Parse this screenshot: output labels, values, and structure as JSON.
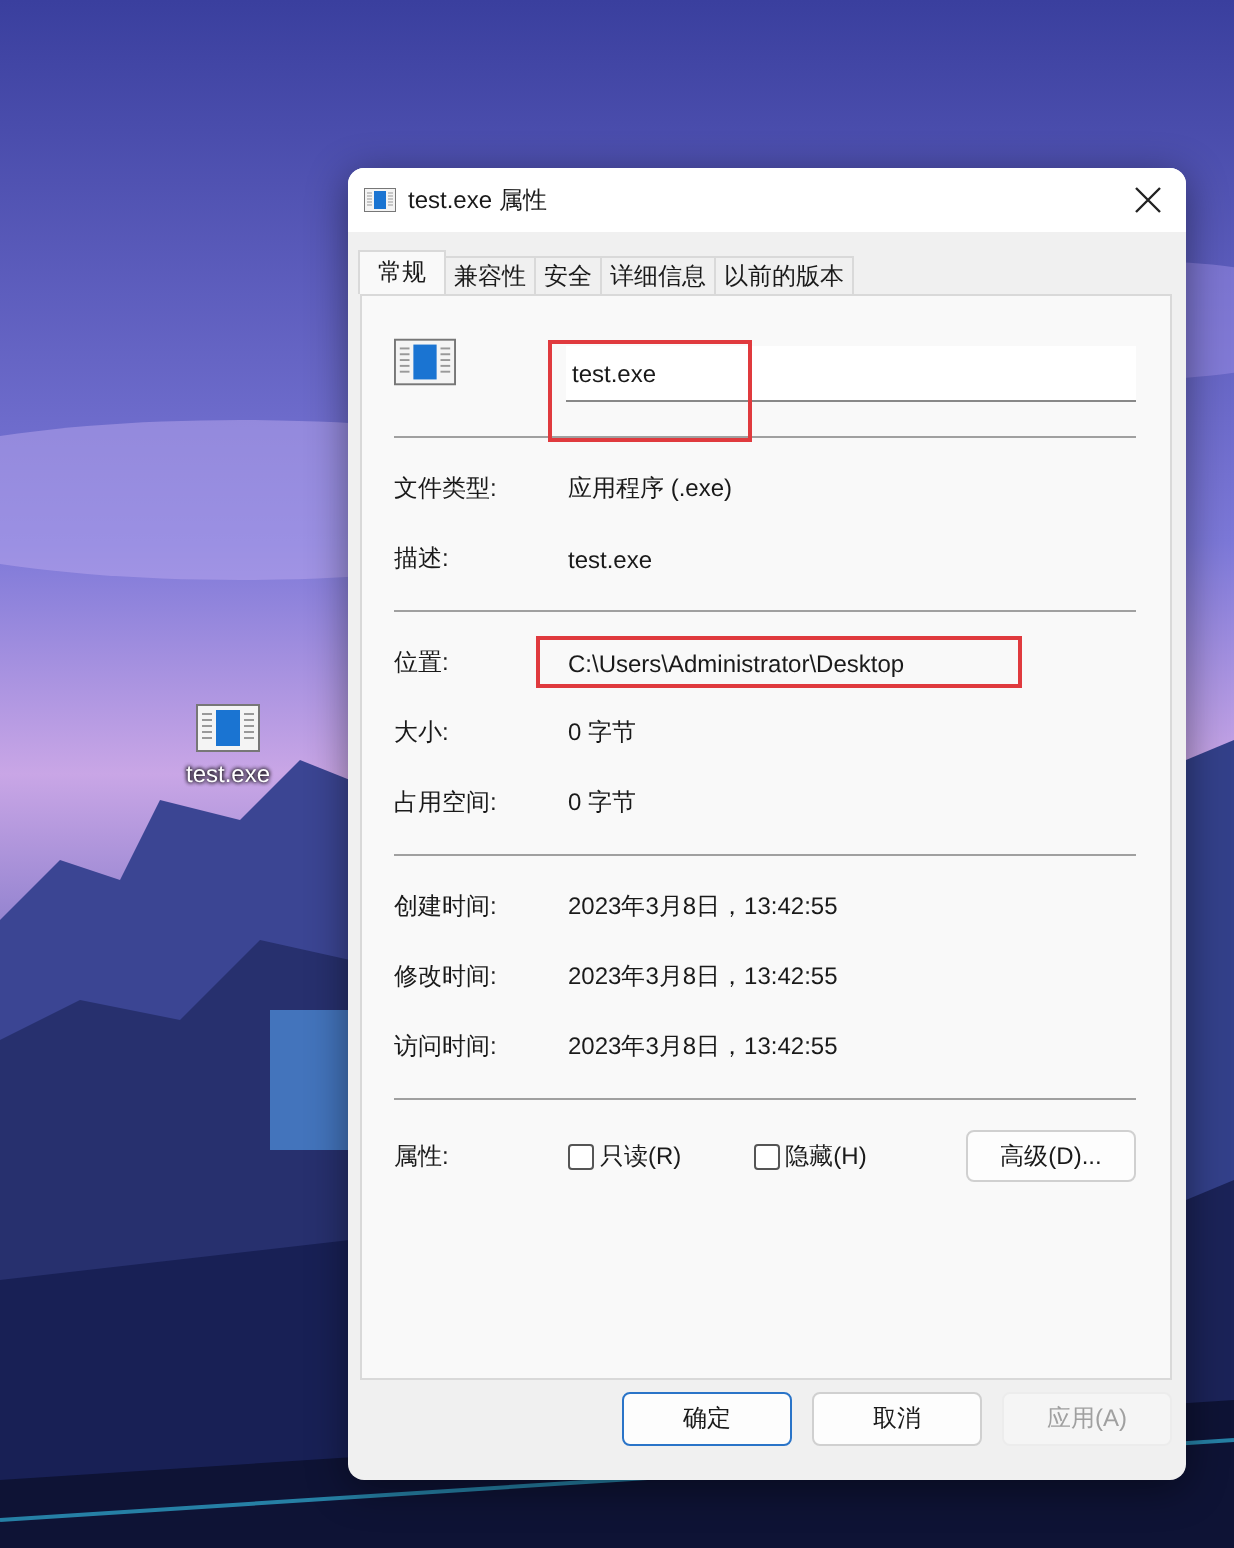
{
  "desktop": {
    "icons": [
      {
        "label": "test.exe"
      }
    ]
  },
  "dialog": {
    "title": "test.exe 属性",
    "tabs": [
      {
        "label": "常规",
        "selected": true
      },
      {
        "label": "兼容性",
        "selected": false
      },
      {
        "label": "安全",
        "selected": false
      },
      {
        "label": "详细信息",
        "selected": false
      },
      {
        "label": "以前的版本",
        "selected": false
      }
    ],
    "name_field": {
      "value": "test.exe",
      "highlighted": true
    },
    "sections": [
      [
        {
          "label": "文件类型:",
          "value": "应用程序 (.exe)",
          "highlighted": false
        },
        {
          "label": "描述:",
          "value": "test.exe",
          "highlighted": false
        }
      ],
      [
        {
          "label": "位置:",
          "value": "C:\\Users\\Administrator\\Desktop",
          "highlighted": true
        },
        {
          "label": "大小:",
          "value": "0 字节",
          "highlighted": false
        },
        {
          "label": "占用空间:",
          "value": "0 字节",
          "highlighted": false
        }
      ],
      [
        {
          "label": "创建时间:",
          "value": "2023年3月8日，13:42:55",
          "highlighted": false
        },
        {
          "label": "修改时间:",
          "value": "2023年3月8日，13:42:55",
          "highlighted": false
        },
        {
          "label": "访问时间:",
          "value": "2023年3月8日，13:42:55",
          "highlighted": false
        }
      ]
    ],
    "attributes": {
      "label": "属性:",
      "checkboxes": [
        {
          "label": "只读(R)",
          "checked": false
        },
        {
          "label": "隐藏(H)",
          "checked": false
        }
      ],
      "advanced_button": "高级(D)..."
    },
    "buttons": [
      {
        "label": "确定",
        "default": true,
        "disabled": false
      },
      {
        "label": "取消",
        "default": false,
        "disabled": false
      },
      {
        "label": "应用(A)",
        "default": false,
        "disabled": true
      }
    ]
  }
}
